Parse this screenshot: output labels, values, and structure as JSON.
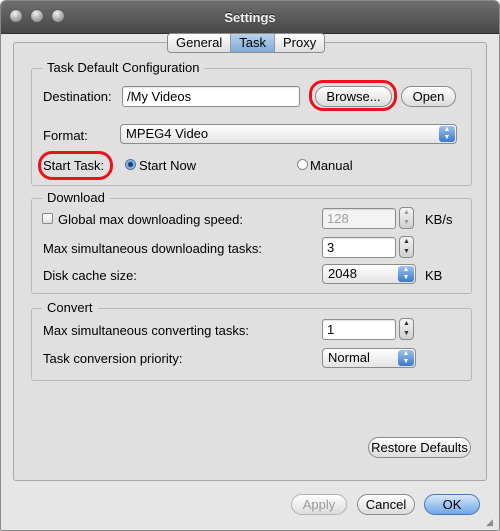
{
  "window": {
    "title": "Settings"
  },
  "tabs": [
    "General",
    "Task",
    "Proxy"
  ],
  "task_default": {
    "legend": "Task Default Configuration",
    "destination_label": "Destination:",
    "destination_value": "/My Videos",
    "browse_label": "Browse...",
    "open_label": "Open",
    "format_label": "Format:",
    "format_value": "MPEG4 Video",
    "start_task_label": "Start Task:",
    "start_now_label": "Start Now",
    "manual_label": "Manual",
    "start_now_selected": true
  },
  "download": {
    "legend": "Download",
    "global_speed_label": "Global max downloading speed:",
    "global_speed_checked": false,
    "global_speed_value": "128",
    "global_speed_unit": "KB/s",
    "max_tasks_label": "Max simultaneous downloading tasks:",
    "max_tasks_value": "3",
    "cache_label": "Disk cache size:",
    "cache_value": "2048",
    "cache_unit": "KB"
  },
  "convert": {
    "legend": "Convert",
    "max_tasks_label": "Max simultaneous converting tasks:",
    "max_tasks_value": "1",
    "priority_label": "Task conversion priority:",
    "priority_value": "Normal"
  },
  "buttons": {
    "restore": "Restore Defaults",
    "apply": "Apply",
    "cancel": "Cancel",
    "ok": "OK"
  },
  "icons": {
    "close": "close-light-icon",
    "minimize": "minimize-light-icon",
    "zoom": "zoom-light-icon",
    "popup": "chevron-updown-icon",
    "stepper": "stepper-arrows-icon",
    "resize": "resize-grip-icon"
  },
  "colors": {
    "highlight_ring": "#e8141c",
    "accent_blue": "#3b79c9"
  }
}
